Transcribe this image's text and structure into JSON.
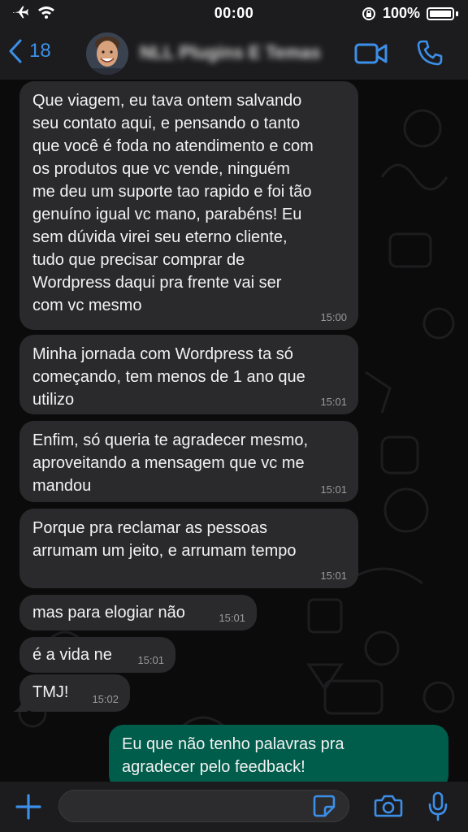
{
  "status": {
    "time": "00:00",
    "battery": "100%"
  },
  "header": {
    "back_count": "18",
    "contact_name": "NLL Plugins E Temas"
  },
  "messages": [
    {
      "lines": [
        "Que viagem, eu tava ontem salvando",
        "seu contato aqui, e pensando o tanto",
        "que você é foda no atendimento e com",
        "os produtos que vc vende, ninguém",
        "me deu um suporte tao rapido e foi tão",
        "genuíno igual vc mano, parabéns! Eu",
        "sem dúvida virei seu eterno cliente,",
        "tudo que precisar comprar de",
        "Wordpress daqui pra frente vai ser",
        "com vc mesmo"
      ],
      "time": "15:00"
    },
    {
      "lines": [
        "Minha jornada com Wordpress ta só",
        "começando, tem menos de 1 ano que",
        "utilizo"
      ],
      "time": "15:01"
    },
    {
      "lines": [
        "Enfim, só queria te agradecer mesmo,",
        "aproveitando a mensagem que vc me",
        "mandou"
      ],
      "time": "15:01"
    },
    {
      "lines": [
        "Porque pra reclamar as pessoas",
        "arrumam um jeito, e arrumam tempo"
      ],
      "time": "15:01"
    },
    {
      "lines": [
        "mas para elogiar não"
      ],
      "time": "15:01"
    },
    {
      "lines": [
        "é a vida ne"
      ],
      "time": "15:01"
    },
    {
      "lines": [
        "TMJ!"
      ],
      "time": "15:02"
    },
    {
      "lines": [
        "Eu que não tenho palavras pra",
        "agradecer pelo feedback!"
      ],
      "time": ""
    }
  ],
  "colors": {
    "accent": "#3c8fe8",
    "incoming": "#2a2a2c",
    "outgoing": "#005c4b"
  }
}
